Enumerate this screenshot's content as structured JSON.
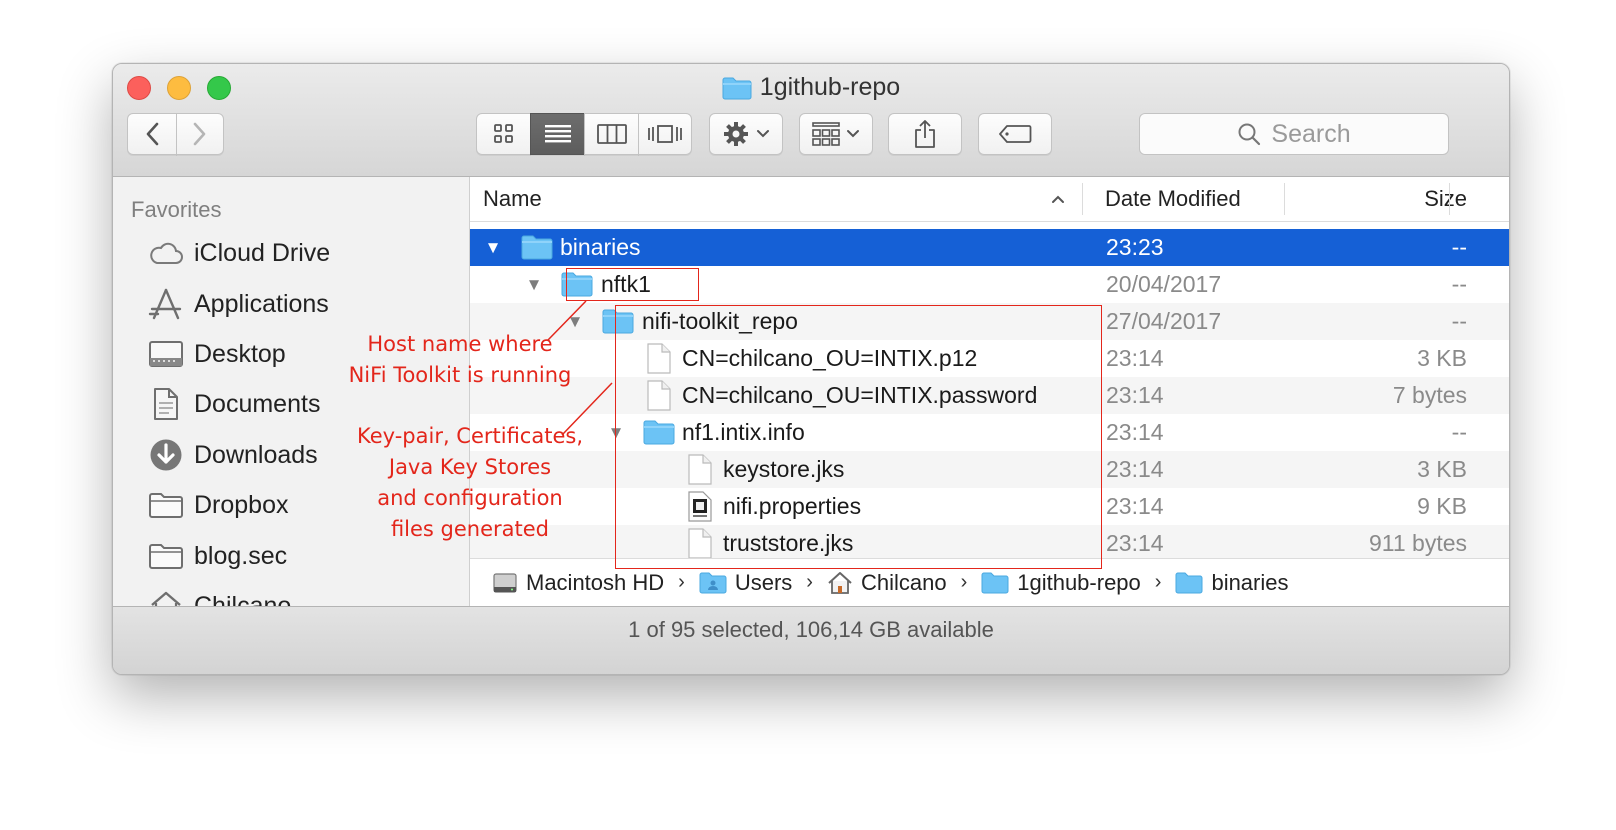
{
  "window": {
    "title": "1github-repo",
    "status": "1 of 95 selected, 106,14 GB available"
  },
  "toolbar": {
    "search_placeholder": "Search",
    "back_icon": "chevron-left-icon",
    "forward_icon": "chevron-right-icon",
    "view_modes": [
      "icon-view",
      "list-view",
      "column-view",
      "cover-flow-view"
    ],
    "selected_view": "list-view"
  },
  "sidebar": {
    "header": "Favorites",
    "items": [
      {
        "label": "iCloud Drive",
        "icon": "cloud-icon"
      },
      {
        "label": "Applications",
        "icon": "applications-icon"
      },
      {
        "label": "Desktop",
        "icon": "desktop-icon"
      },
      {
        "label": "Documents",
        "icon": "documents-icon"
      },
      {
        "label": "Downloads",
        "icon": "downloads-icon"
      },
      {
        "label": "Dropbox",
        "icon": "folder-icon"
      },
      {
        "label": "blog.sec",
        "icon": "folder-icon"
      },
      {
        "label": "Chilcano",
        "icon": "home-icon"
      }
    ]
  },
  "columns": {
    "name": "Name",
    "date": "Date Modified",
    "size": "Size"
  },
  "files": [
    {
      "name": "binaries",
      "date": "23:23",
      "size": "--",
      "type": "folder",
      "depth": 0,
      "expanded": true,
      "selected": true
    },
    {
      "name": "nftk1",
      "date": "20/04/2017",
      "size": "--",
      "type": "folder",
      "depth": 1,
      "expanded": true
    },
    {
      "name": "nifi-toolkit_repo",
      "date": "27/04/2017",
      "size": "--",
      "type": "folder",
      "depth": 2,
      "expanded": true
    },
    {
      "name": "CN=chilcano_OU=INTIX.p12",
      "date": "23:14",
      "size": "3 KB",
      "type": "file",
      "depth": 3
    },
    {
      "name": "CN=chilcano_OU=INTIX.password",
      "date": "23:14",
      "size": "7 bytes",
      "type": "file",
      "depth": 3
    },
    {
      "name": "nf1.intix.info",
      "date": "23:14",
      "size": "--",
      "type": "folder",
      "depth": 3,
      "expanded": true
    },
    {
      "name": "keystore.jks",
      "date": "23:14",
      "size": "3 KB",
      "type": "file",
      "depth": 4
    },
    {
      "name": "nifi.properties",
      "date": "23:14",
      "size": "9 KB",
      "type": "java-file",
      "depth": 4
    },
    {
      "name": "truststore.jks",
      "date": "23:14",
      "size": "911 bytes",
      "type": "file",
      "depth": 4
    }
  ],
  "path": [
    {
      "label": "Macintosh HD",
      "icon": "hard-drive-icon"
    },
    {
      "label": "Users",
      "icon": "users-folder-icon"
    },
    {
      "label": "Chilcano",
      "icon": "home-icon"
    },
    {
      "label": "1github-repo",
      "icon": "folder-icon"
    },
    {
      "label": "binaries",
      "icon": "folder-icon"
    }
  ],
  "annotations": {
    "host_label": [
      "Host name where",
      "NiFi Toolkit is running"
    ],
    "files_label": [
      "Key-pair, Certificates,",
      "Java Key Stores",
      "and configuration",
      "files generated"
    ],
    "color": "#e3261b"
  },
  "colors": {
    "selection": "#1560d6",
    "folder": "#6cc3f5",
    "annotation": "#e3261b"
  }
}
